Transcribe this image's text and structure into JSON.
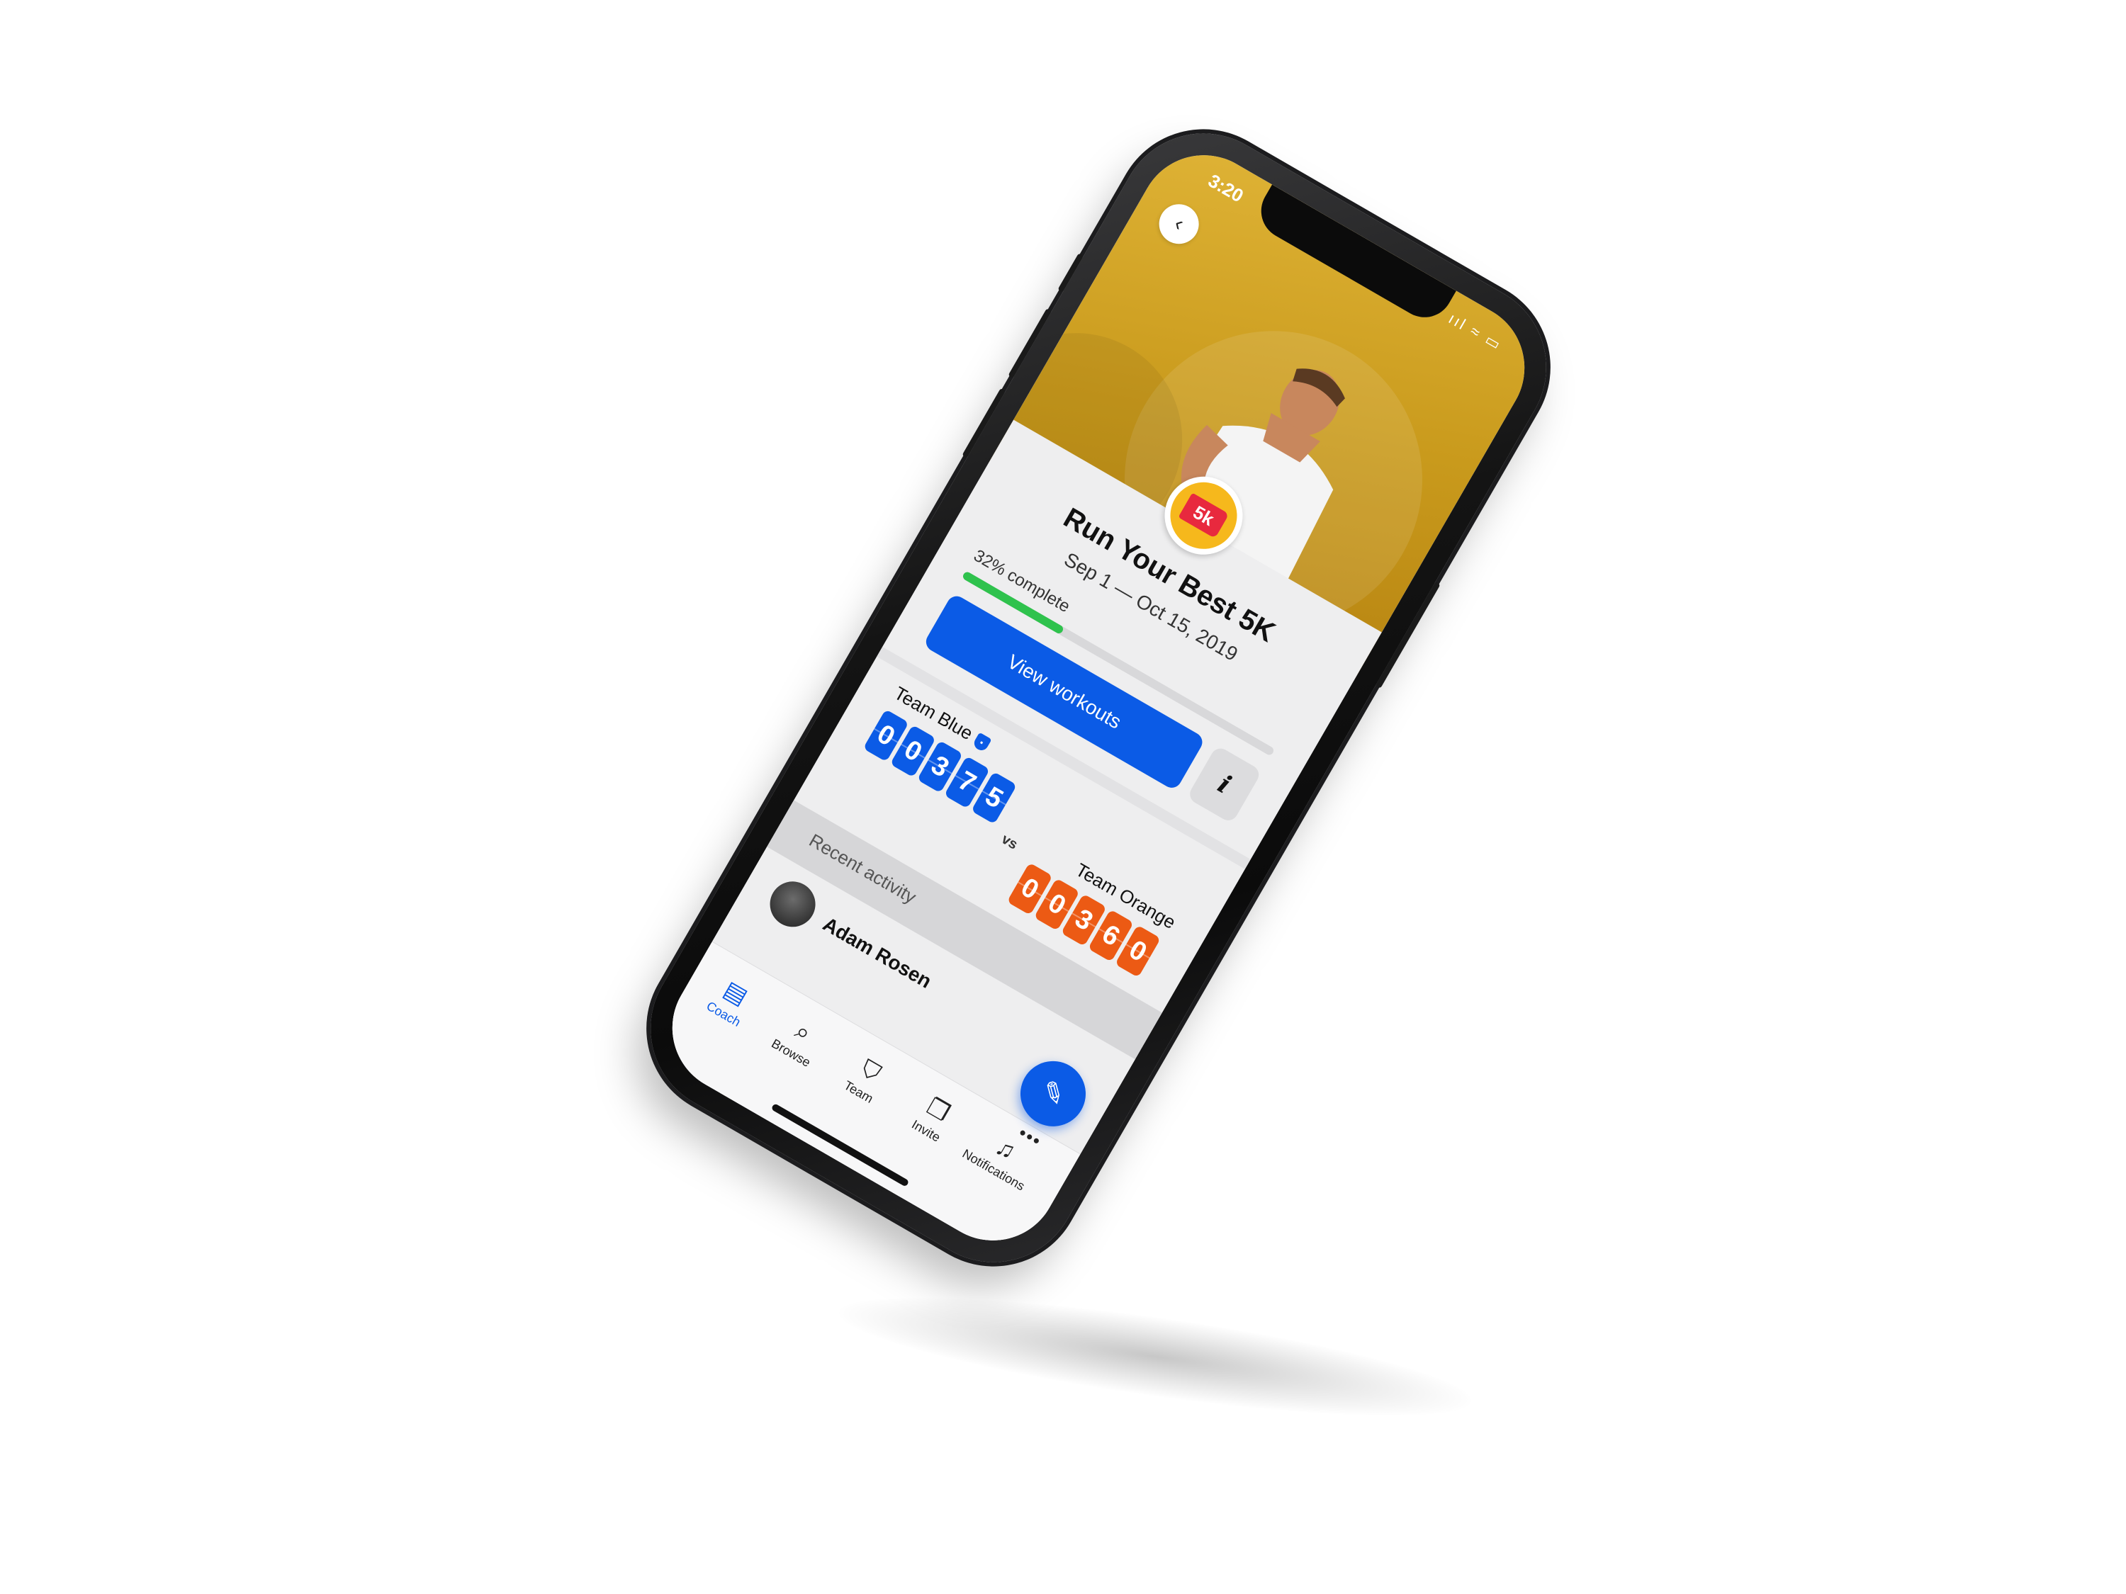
{
  "status_bar": {
    "time": "3:20",
    "icons": "ııl ≈ ▭"
  },
  "hero": {
    "badge_text": "5k"
  },
  "challenge": {
    "title": "Run Your Best 5K",
    "dates": "Sep 1 — Oct 15, 2019",
    "progress_label": "32% complete",
    "progress_percent": 32,
    "cta_label": "View workouts",
    "info_label": "i"
  },
  "teams": {
    "blue": {
      "name": "Team Blue",
      "score_digits": [
        "0",
        "0",
        "3",
        "7",
        "5"
      ],
      "color": "#0b5be6"
    },
    "vs_label": "vs",
    "orange": {
      "name": "Team Orange",
      "score_digits": [
        "0",
        "0",
        "3",
        "6",
        "0"
      ],
      "color": "#ec5a14"
    }
  },
  "recent": {
    "label": "Recent activity",
    "items": [
      {
        "name": "Adam Rosen"
      }
    ]
  },
  "tabbar": {
    "items": [
      {
        "label": "Coach",
        "icon": "clipboard-icon",
        "active": true
      },
      {
        "label": "Browse",
        "icon": "search-icon",
        "active": false
      },
      {
        "label": "Team",
        "icon": "shield-icon",
        "active": false
      },
      {
        "label": "Invite",
        "icon": "cards-icon",
        "active": false
      },
      {
        "label": "Notifications",
        "icon": "bell-icon",
        "active": false
      }
    ]
  },
  "fab": {
    "icon": "compose-icon",
    "more": "•••"
  },
  "colors": {
    "accent": "#0b5be6",
    "progress": "#2fc24d",
    "hero_gold": "#d4a52a",
    "orange": "#ec5a14",
    "badge_red": "#e8293e"
  }
}
